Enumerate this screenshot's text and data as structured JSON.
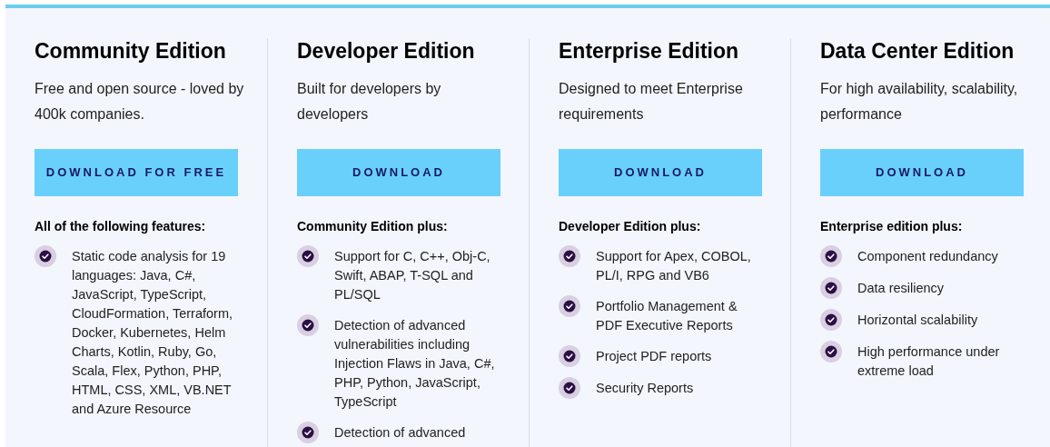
{
  "editions": [
    {
      "title": "Community Edition",
      "description": "Free and open source - loved by 400k companies.",
      "button": "DOWNLOAD FOR FREE",
      "features_heading": "All of the following features:",
      "features": [
        "Static code analysis for 19 languages: Java, C#, JavaScript, TypeScript, CloudFormation, Terraform, Docker, Kubernetes, Helm Charts, Kotlin, Ruby, Go, Scala, Flex, Python, PHP, HTML, CSS, XML, VB.NET and Azure Resource"
      ]
    },
    {
      "title": "Developer Edition",
      "description": "Built for developers by developers",
      "button": "DOWNLOAD",
      "features_heading": "Community Edition plus:",
      "features": [
        "Support for C, C++, Obj-C, Swift, ABAP, T-SQL and PL/SQL",
        "Detection of advanced vulnerabilities including Injection Flaws in Java, C#, PHP, Python, JavaScript, TypeScript",
        "Detection of advanced"
      ]
    },
    {
      "title": "Enterprise Edition",
      "description": "Designed to meet Enterprise requirements",
      "button": "DOWNLOAD",
      "features_heading": "Developer Edition plus:",
      "features": [
        "Support for Apex, COBOL, PL/I, RPG and VB6",
        "Portfolio Management & PDF Executive Reports",
        "Project PDF reports",
        "Security Reports"
      ]
    },
    {
      "title": "Data Center Edition",
      "description": "For high availability, scalability, performance",
      "button": "DOWNLOAD",
      "features_heading": "Enterprise edition plus:",
      "features": [
        "Component redundancy",
        "Data resiliency",
        "Horizontal scalability",
        "High performance under extreme load"
      ]
    }
  ]
}
